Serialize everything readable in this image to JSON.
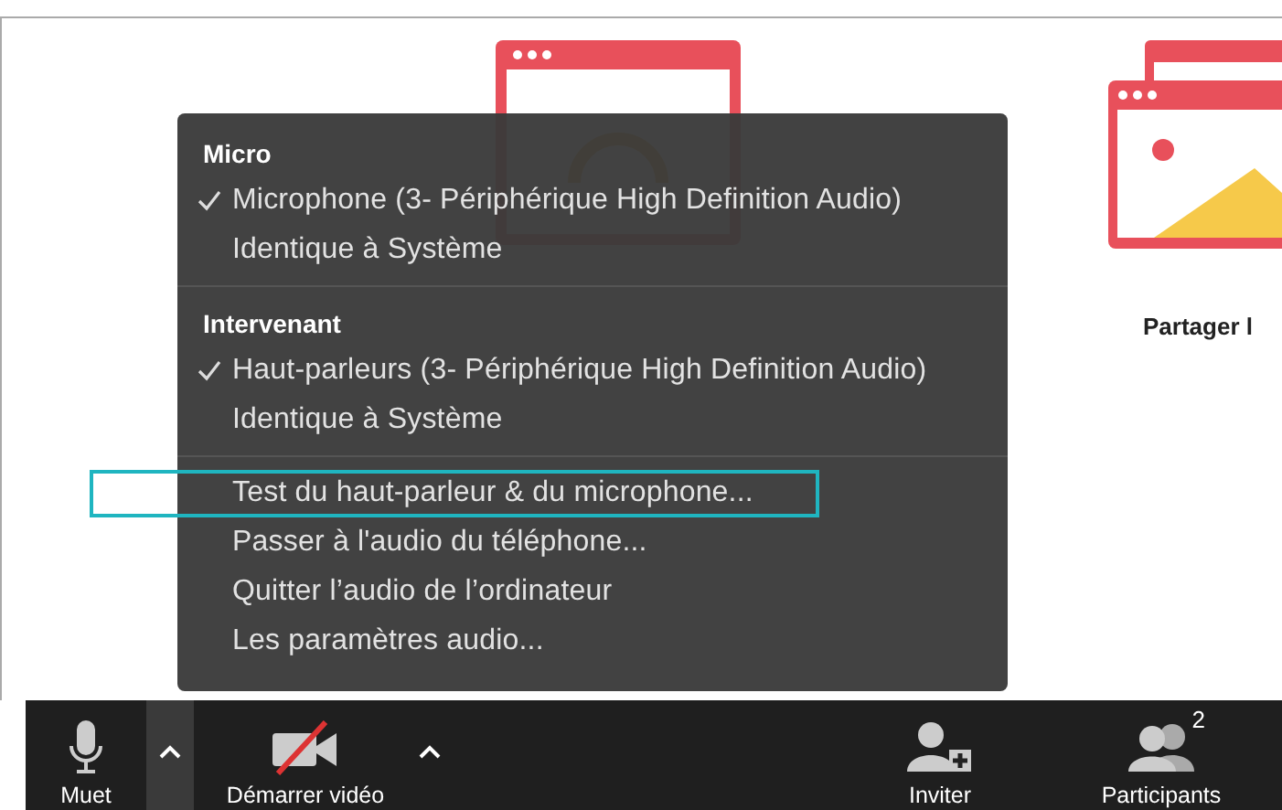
{
  "background": {
    "share_label": "Partager l"
  },
  "menu": {
    "sections": [
      {
        "header": "Micro",
        "items": [
          {
            "label": "Microphone (3- Périphérique High Definition Audio)",
            "checked": true,
            "highlighted": false
          },
          {
            "label": "Identique à Système",
            "checked": false,
            "highlighted": false
          }
        ]
      },
      {
        "header": "Intervenant",
        "items": [
          {
            "label": "Haut-parleurs (3- Périphérique High Definition Audio)",
            "checked": true,
            "highlighted": false
          },
          {
            "label": "Identique à Système",
            "checked": false,
            "highlighted": false
          }
        ]
      },
      {
        "items": [
          {
            "label": "Test du haut-parleur & du microphone...",
            "checked": false,
            "highlighted": true
          },
          {
            "label": "Passer à l'audio du téléphone...",
            "checked": false,
            "highlighted": false
          },
          {
            "label": "Quitter l’audio de l’ordinateur",
            "checked": false,
            "highlighted": false
          },
          {
            "label": "Les paramètres audio...",
            "checked": false,
            "highlighted": false
          }
        ]
      }
    ]
  },
  "toolbar": {
    "buttons": [
      {
        "kind": "mic",
        "label": "Muet"
      },
      {
        "kind": "caret",
        "selected": true
      },
      {
        "kind": "video",
        "label": "Démarrer vidéo",
        "off": true
      },
      {
        "kind": "caret",
        "selected": false
      },
      {
        "kind": "spacer"
      },
      {
        "kind": "invite",
        "label": "Inviter"
      },
      {
        "kind": "participants",
        "label": "Participants",
        "count": "2"
      }
    ]
  }
}
